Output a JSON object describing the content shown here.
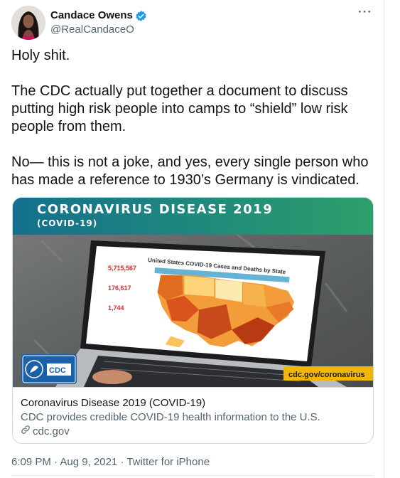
{
  "author": {
    "display_name": "Candace Owens",
    "handle": "@RealCandaceO",
    "verified_icon": "verified-badge-icon"
  },
  "tweet": {
    "paragraphs": [
      "Holy shit.",
      "The CDC actually put together a document to discuss putting high risk people into camps to “shield” low risk people from them.",
      "No— this is not a joke, and yes, every single person who has made a reference to 1930’s Germany is vindicated."
    ]
  },
  "card": {
    "image_banner_title": "CORONAVIRUS DISEASE 2019",
    "image_banner_subtitle": "(COVID-19)",
    "image_screen_heading": "United States COVID-19 Cases and Deaths by State",
    "image_cdc_logo_text": "CDC",
    "image_url_label": "cdc.gov/coronavirus",
    "title": "Coronavirus Disease 2019 (COVID-19)",
    "description": "CDC provides credible COVID-19 health information to the U.S.",
    "domain": "cdc.gov"
  },
  "meta": {
    "timestamp": "6:09 PM · Aug 9, 2021 · Twitter for iPhone"
  },
  "colors": {
    "banner": "#1f8a86",
    "accent_yellow": "#f2b705",
    "cdc_blue": "#1a61a8",
    "verified_blue": "#1d9bf0"
  }
}
